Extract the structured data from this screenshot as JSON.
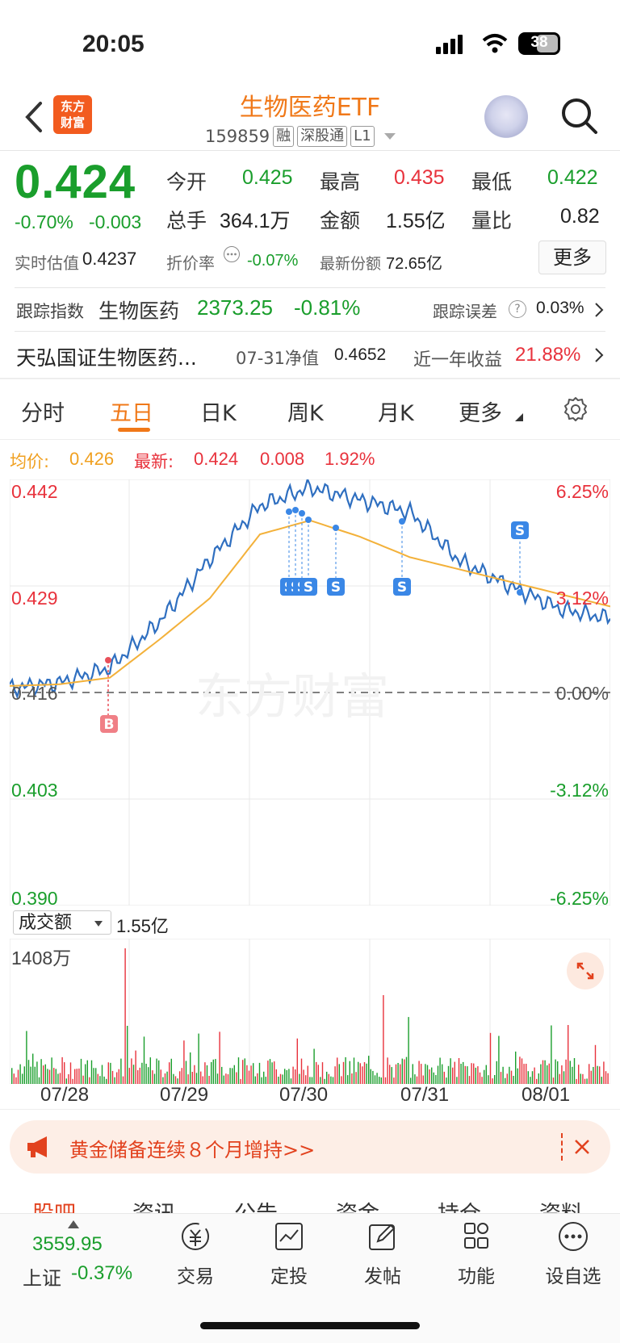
{
  "status": {
    "time": "20:05",
    "battery": "38"
  },
  "header": {
    "title": "生物医药ETF",
    "code": "159859",
    "tags": [
      "融",
      "深股通",
      "L1"
    ],
    "logo_line1": "东方",
    "logo_line2": "财富"
  },
  "quote": {
    "price": "0.424",
    "change_pct": "-0.70%",
    "change": "-0.003",
    "open_label": "今开",
    "open": "0.425",
    "high_label": "最高",
    "high": "0.435",
    "low_label": "最低",
    "low": "0.422",
    "volume_label": "总手",
    "volume": "364.1万",
    "amount_label": "金额",
    "amount": "1.55亿",
    "ratio_label": "量比",
    "ratio": "0.82",
    "iopv_label": "实时估值",
    "iopv": "0.4237",
    "premium_label": "折价率",
    "premium": "-0.07%",
    "shares_label": "最新份额",
    "shares": "72.65亿",
    "more_label": "更多"
  },
  "tracking": {
    "label": "跟踪指数",
    "index_name": "生物医药",
    "index_value": "2373.25",
    "index_change": "-0.81%",
    "error_label": "跟踪误差",
    "error_value": "0.03%"
  },
  "fund": {
    "name": "天弘国证生物医药...",
    "nav_label": "07-31净值",
    "nav": "0.4652",
    "yield_label": "近一年收益",
    "yield": "21.88%"
  },
  "tabs": [
    {
      "label": "分时"
    },
    {
      "label": "五日"
    },
    {
      "label": "日K"
    },
    {
      "label": "周K"
    },
    {
      "label": "月K"
    },
    {
      "label": "更多"
    }
  ],
  "chart_info": {
    "avg_label": "均价:",
    "avg": "0.426",
    "latest_label": "最新:",
    "latest": "0.424",
    "chg": "0.008",
    "chg_pct": "1.92%"
  },
  "y_left": [
    "0.442",
    "0.429",
    "0.416",
    "0.403",
    "0.390"
  ],
  "y_right": [
    "6.25%",
    "3.12%",
    "0.00%",
    "-3.12%",
    "-6.25%"
  ],
  "volume_panel": {
    "selector": "成交额",
    "total": "1.55亿",
    "max": "1408万"
  },
  "x_labels": [
    "07/28",
    "07/29",
    "07/30",
    "07/31",
    "08/01"
  ],
  "marker_b": "B",
  "marker_s": "S",
  "chart_data": {
    "type": "line",
    "title": "",
    "x": [
      "07/28",
      "07/29",
      "07/30",
      "07/31",
      "08/01"
    ],
    "ylim": [
      0.39,
      0.442
    ],
    "series": [
      {
        "name": "",
        "values": [
          0.4165,
          0.4172,
          0.419,
          0.4247,
          0.4323,
          0.4388,
          0.441,
          0.4395,
          0.438,
          0.432,
          0.429,
          0.4262,
          0.425
        ]
      },
      {
        "name": "均价",
        "values": [
          0.4168,
          0.417,
          0.4178,
          0.4225,
          0.4275,
          0.4353,
          0.437,
          0.435,
          0.4325,
          0.431,
          0.4295,
          0.428,
          0.4265
        ]
      }
    ]
  }
}
